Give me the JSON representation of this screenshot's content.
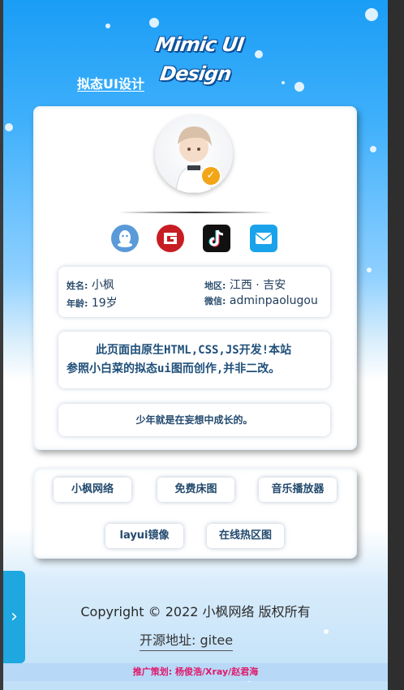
{
  "header": {
    "logo_text": "Mimic UI Design",
    "subtitle": "拟态UI设计"
  },
  "profile": {
    "avatar": "avatar-image",
    "verified_icon": "verified-badge-icon",
    "social": [
      {
        "name": "qq",
        "icon": "qq-penguin-icon",
        "color": "#5a9ad8"
      },
      {
        "name": "gitee",
        "icon": "gitee-logo-icon",
        "color": "#c71d23"
      },
      {
        "name": "tiktok",
        "icon": "tiktok-logo-icon",
        "color": "#111111"
      },
      {
        "name": "email",
        "icon": "envelope-icon",
        "color": "#1aa3ea"
      }
    ],
    "info": {
      "name_label": "姓名:",
      "name_value": "小枫",
      "age_label": "年龄:",
      "age_value": "19岁",
      "region_label": "地区:",
      "region_value": "江西 · 吉安",
      "wechat_label": "微信:",
      "wechat_value": "adminpaolugou"
    },
    "description_line1": "此页面由原生HTML,CSS,JS开发!本站",
    "description_line2": "参照小白菜的拟态ui图而创作,并非二改。",
    "motto": "少年就是在妄想中成长的。"
  },
  "links": [
    {
      "label": "小枫网络"
    },
    {
      "label": "免费床图"
    },
    {
      "label": "音乐播放器"
    },
    {
      "label": "layui镜像"
    },
    {
      "label": "在线热区图"
    }
  ],
  "footer": {
    "copyright": "Copyright © 2022 小枫网络 版权所有",
    "source_label": "开源地址:",
    "source_link": "gitee",
    "promo": "推广策划: 杨俊浩/Xray/赵君海"
  },
  "side_tab": {
    "icon": "chevron-right-icon"
  },
  "colors": {
    "accent": "#1a9df5",
    "text_dark": "#234a6e",
    "promo": "#e0186c"
  }
}
